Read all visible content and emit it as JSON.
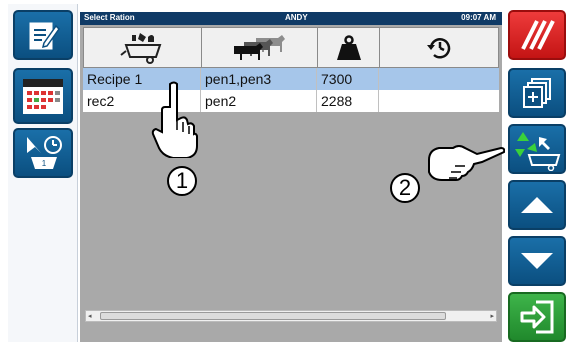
{
  "title_bar": {
    "screen_title": "Select Ration",
    "user": "ANDY",
    "time": "09:07 AM"
  },
  "table": {
    "column_icons": [
      "mixer-wagon-ingredients-icon",
      "cattle-group-icon",
      "weight-icon",
      "history-clock-icon"
    ],
    "rows": [
      {
        "recipe": "Recipe 1",
        "pens": "pen1,pen3",
        "weight": "7300",
        "extra": "",
        "selected": true
      },
      {
        "recipe": "rec2",
        "pens": "pen2",
        "weight": "2288",
        "extra": "",
        "selected": false
      }
    ]
  },
  "left_toolbar": [
    "edit-notepad-icon",
    "calendar-icon",
    "feed-schedule-icon"
  ],
  "right_toolbar": [
    "cancel-hatch-icon",
    "add-copy-icon",
    "recycle-wagon-icon",
    "arrow-up-icon",
    "arrow-down-icon",
    "enter-arrow-icon"
  ],
  "annotations": {
    "step1": "1",
    "step2": "2"
  },
  "colors": {
    "title_bar": "#0f3a66",
    "selected_row": "#a6c6ea",
    "blue_button": "#1a6fa8",
    "red_button": "#e52b2b",
    "green_button": "#2fa33c",
    "panel_gray": "#a9a9a9"
  }
}
